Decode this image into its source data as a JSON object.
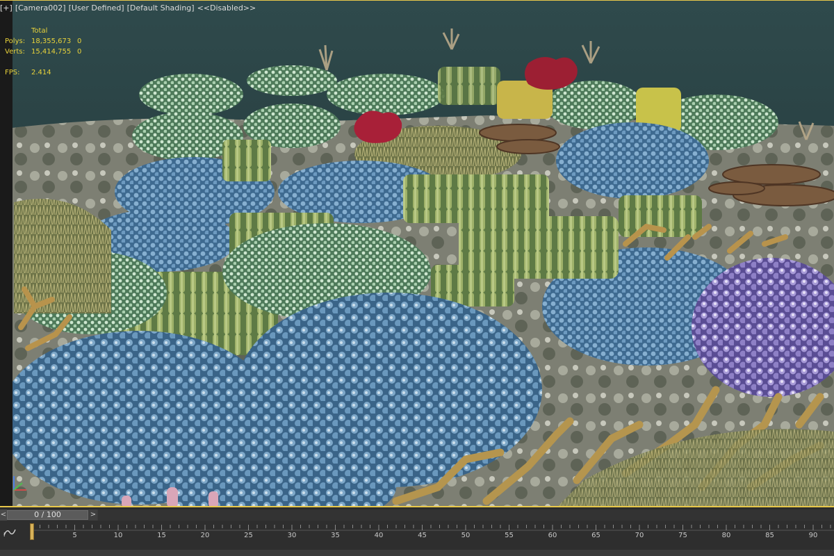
{
  "viewport": {
    "plus": "[+]",
    "camera": "[Camera002]",
    "mode": "[User Defined]",
    "shading": "[Default Shading]",
    "state": "<<Disabled>>"
  },
  "stats": {
    "header": "Total",
    "polys_label": "Polys:",
    "polys_value": "18,355,673",
    "polys_sel": "0",
    "verts_label": "Verts:",
    "verts_value": "15,414,755",
    "verts_sel": "0",
    "fps_label": "FPS:",
    "fps_value": "2.414"
  },
  "time_slider": {
    "position": "0 / 100",
    "prev_symbol": "<",
    "next_symbol": ">"
  },
  "track_bar": {
    "curve_icon": "curve-editor-icon",
    "ticks": [
      "5",
      "10",
      "15",
      "20",
      "25",
      "30",
      "35",
      "40",
      "45",
      "50",
      "55",
      "60",
      "65",
      "70",
      "75",
      "80",
      "85",
      "90"
    ]
  },
  "colors": {
    "stats_text": "#e8d23a",
    "viewport_border": "#e8c84a",
    "ui_dark": "#2e2e2e"
  }
}
